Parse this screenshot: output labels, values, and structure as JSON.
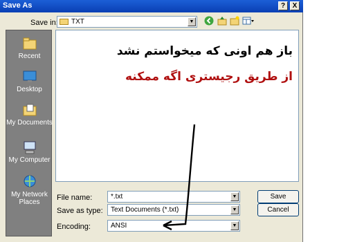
{
  "window": {
    "title": "Save As",
    "help_btn": "?",
    "close_btn": "X"
  },
  "toolbar": {
    "save_in_label": "Save in:",
    "save_in_value": "TXT"
  },
  "places": [
    {
      "label": "Recent",
      "icon": "recent-icon"
    },
    {
      "label": "Desktop",
      "icon": "desktop-icon"
    },
    {
      "label": "My Documents",
      "icon": "my-documents-icon"
    },
    {
      "label": "My Computer",
      "icon": "my-computer-icon"
    },
    {
      "label": "My Network Places",
      "icon": "network-icon"
    }
  ],
  "annotation": {
    "line1": "باز هم اونی که میخواستم نشد",
    "line2": "از طریق رجیستری اگه ممکنه",
    "line2_color": "#b01010"
  },
  "fields": {
    "file_name_label": "File name:",
    "file_name_value": "*.txt",
    "save_as_type_label": "Save as type:",
    "save_as_type_value": "Text Documents (*.txt)",
    "encoding_label": "Encoding:",
    "encoding_value": "ANSI"
  },
  "buttons": {
    "save": "Save",
    "cancel": "Cancel"
  }
}
